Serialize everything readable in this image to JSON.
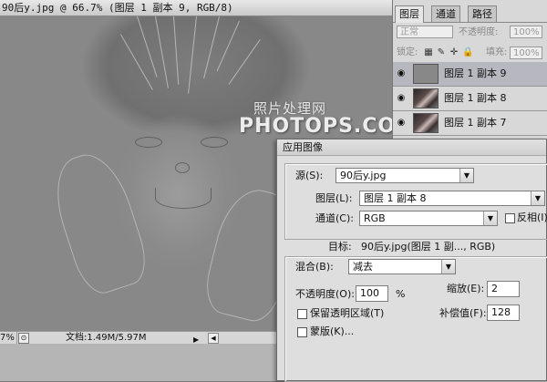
{
  "document": {
    "title": "90后y.jpg @ 66.7% (图层 1 副本 9, RGB/8)",
    "watermark_cn": "照片处理网",
    "watermark_en": "PHOTOPS.COM",
    "status": {
      "zoom": "7%",
      "doc_info": "文档:1.49M/5.97M",
      "arrow": "▶",
      "scroll_left": "◀"
    }
  },
  "layers_panel": {
    "tabs": [
      "图层",
      "通道",
      "路径"
    ],
    "active_tab": 0,
    "blend_mode": "正常",
    "opacity_label": "不透明度:",
    "opacity_value": "100%",
    "lock_label": "锁定:",
    "fill_label": "填充:",
    "fill_value": "100%",
    "lock_icons": [
      "▦",
      "✎",
      "✛",
      "🔒"
    ],
    "layers": [
      {
        "name": "图层 1 副本 9",
        "visible": true,
        "selected": true
      },
      {
        "name": "图层 1 副本 8",
        "visible": true,
        "selected": false
      },
      {
        "name": "图层 1 副本 7",
        "visible": true,
        "selected": false
      }
    ],
    "eye_icon": "◉"
  },
  "apply_image": {
    "title": "应用图像",
    "source_label": "源(S):",
    "source_value": "90后y.jpg",
    "layer_label": "图层(L):",
    "layer_value": "图层 1 副本 8",
    "channel_label": "通道(C):",
    "channel_value": "RGB",
    "invert_label": "反相(I)",
    "target_label": "目标:",
    "target_value": "90后y.jpg(图层 1 副..., RGB)",
    "blending_label": "混合(B):",
    "blending_value": "减去",
    "opacity_label": "不透明度(O):",
    "opacity_value": "100",
    "opacity_unit": "%",
    "scale_label": "缩放(E):",
    "scale_value": "2",
    "offset_label": "补偿值(F):",
    "offset_value": "128",
    "preserve_label": "保留透明区域(T)",
    "mask_label": "蒙版(K)...",
    "dropdown_icon": "▼"
  }
}
